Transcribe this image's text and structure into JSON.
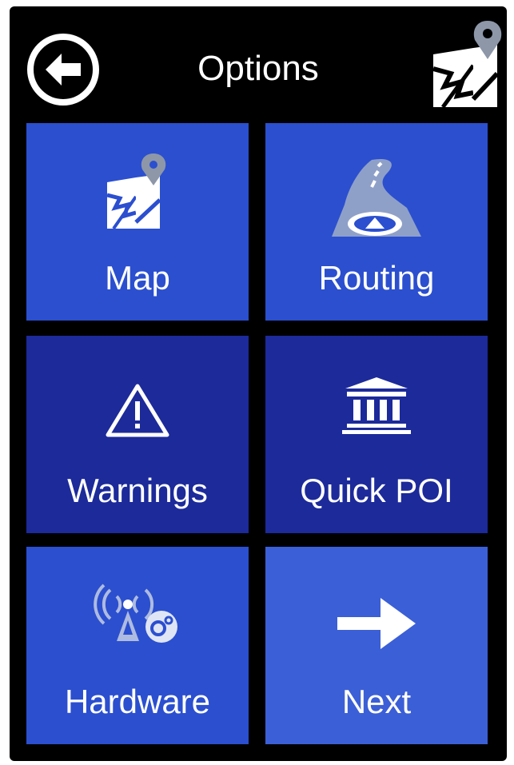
{
  "header": {
    "title": "Options",
    "back_icon": "back-arrow-icon",
    "shortcut_icon": "map-pin-icon"
  },
  "colors": {
    "background": "#000000",
    "tile_bright": "#2b4fcf",
    "tile_dark": "#1c2a9a",
    "tile_next": "#3b5fd6"
  },
  "tiles": [
    {
      "label": "Map",
      "icon": "map-icon"
    },
    {
      "label": "Routing",
      "icon": "road-icon"
    },
    {
      "label": "Warnings",
      "icon": "warning-triangle-icon"
    },
    {
      "label": "Quick POI",
      "icon": "landmark-icon"
    },
    {
      "label": "Hardware",
      "icon": "gps-antenna-settings-icon"
    },
    {
      "label": "Next",
      "icon": "arrow-right-icon"
    }
  ]
}
